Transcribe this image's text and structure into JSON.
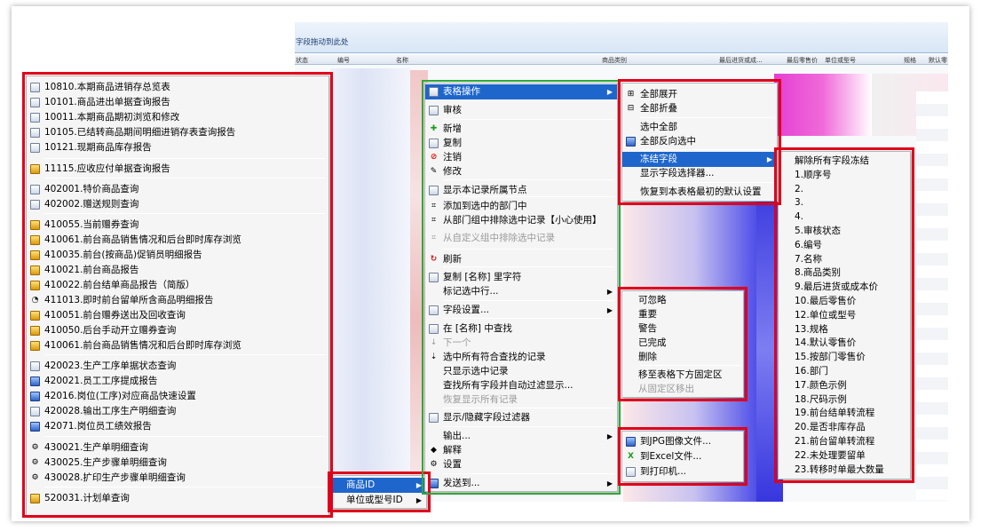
{
  "background_grid": {
    "drag_hint": "字段拖动到此处",
    "columns": [
      "状态",
      "编号",
      "名称",
      "商品类别",
      "最后进货或成...",
      "最后零售价",
      "单位或型号",
      "规格",
      "默认零"
    ]
  },
  "reports_menu": {
    "items": [
      {
        "label": "10810.本期商品进销存总览表",
        "icon": "report-icon"
      },
      {
        "label": "10101.商品进出单据查询报告",
        "icon": "report-icon"
      },
      {
        "label": "10011.本期商品期初浏览和修改",
        "icon": "report-icon"
      },
      {
        "label": "10105.已结转商品期间明细进销存表查询报告",
        "icon": "report-icon"
      },
      {
        "label": "10121.现期商品库存报告",
        "icon": "report-icon"
      },
      {
        "label": "11115.应收应付单据查询报告",
        "icon": "chart-icon"
      },
      {
        "label": "402001.特价商品查询",
        "icon": "report-icon"
      },
      {
        "label": "402002.赠送规则查询",
        "icon": "report-icon"
      },
      {
        "label": "410055.当前赠券查询",
        "icon": "coupon-icon"
      },
      {
        "label": "410061.前台商品销售情况和后台即时库存浏览",
        "icon": "coupon-icon"
      },
      {
        "label": "410035.前台(按商品)促销员明细报告",
        "icon": "coupon-icon"
      },
      {
        "label": "410021.前台商品报告",
        "icon": "coupon-icon"
      },
      {
        "label": "410022.前台结单商品报告（简版）",
        "icon": "coupon-icon"
      },
      {
        "label": "411013.即时前台留单所含商品明细报告",
        "icon": "clock-icon"
      },
      {
        "label": "410051.前台赠券送出及回收查询",
        "icon": "coupon-icon"
      },
      {
        "label": "410050.后台手动开立赠券查询",
        "icon": "coupon-icon"
      },
      {
        "label": "410061.前台商品销售情况和后台即时库存浏览",
        "icon": "coupon-icon"
      },
      {
        "label": "420023.生产工序单据状态查询",
        "icon": "report-icon"
      },
      {
        "label": "420021.员工工序提成报告",
        "icon": "staff-icon"
      },
      {
        "label": "42016.岗位(工序)对应商品快速设置",
        "icon": "staff-icon"
      },
      {
        "label": "420028.输出工序生产明细查询",
        "icon": "report-icon"
      },
      {
        "label": "42071.岗位员工绩效报告",
        "icon": "staff-icon"
      },
      {
        "label": "430021.生产单明细查询",
        "icon": "gear-icon"
      },
      {
        "label": "430025.生产步骤单明细查询",
        "icon": "gear-icon"
      },
      {
        "label": "430028.扩印生产步骤单明细查询",
        "icon": "gear-icon"
      },
      {
        "label": "520031.计划单查询",
        "icon": "pencil-icon"
      }
    ]
  },
  "field_menu": {
    "items": [
      {
        "label": "商品ID",
        "highlighted": true
      },
      {
        "label": "单位或型号ID",
        "highlighted": false
      }
    ]
  },
  "context_menu": {
    "items": [
      {
        "label": "表格操作",
        "icon": "table-icon",
        "submenu": true,
        "highlighted": true
      },
      {
        "label": "审核",
        "icon": "check-icon"
      },
      {
        "label": "新增",
        "icon": "add-icon"
      },
      {
        "label": "复制",
        "icon": "copy-icon"
      },
      {
        "label": "注销",
        "icon": "cancel-icon"
      },
      {
        "label": "修改",
        "icon": "edit-icon"
      },
      {
        "label": "显示本记录所属节点",
        "icon": "node-icon"
      },
      {
        "label": "添加到选中的部门中",
        "icon": "dept-add-icon"
      },
      {
        "label": "从部门组中排除选中记录【小心使用】",
        "icon": "dept-remove-icon"
      },
      {
        "label": "从自定义组中排除选中记录",
        "icon": "group-remove-icon",
        "disabled": true
      },
      {
        "label": "刷新",
        "icon": "refresh-icon"
      },
      {
        "label": "复制 [名称] 里字符",
        "icon": "copy-icon"
      },
      {
        "label": "标记选中行...",
        "icon": "",
        "submenu": true
      },
      {
        "label": "字段设置...",
        "icon": "field-icon",
        "submenu": true
      },
      {
        "label": "在 [名称] 中查找",
        "icon": "find-icon"
      },
      {
        "label": "下一个",
        "icon": "next-icon",
        "disabled": true
      },
      {
        "label": "选中所有符合查找的记录",
        "icon": "select-icon"
      },
      {
        "label": "只显示选中记录",
        "icon": ""
      },
      {
        "label": "查找所有字段并自动过滤显示...",
        "icon": ""
      },
      {
        "label": "恢复显示所有记录",
        "icon": "",
        "disabled": true
      },
      {
        "label": "显示/隐藏字段过滤器",
        "icon": "filter-icon"
      },
      {
        "label": "输出...",
        "icon": "",
        "submenu": true
      },
      {
        "label": "解释",
        "icon": "info-icon"
      },
      {
        "label": "设置",
        "icon": "settings-icon"
      },
      {
        "label": "发送到...",
        "icon": "send-icon",
        "submenu": true
      }
    ]
  },
  "table_ops_menu": {
    "items": [
      {
        "label": "全部展开",
        "icon": "expand-icon"
      },
      {
        "label": "全部折叠",
        "icon": "collapse-icon"
      },
      {
        "label": "选中全部",
        "icon": ""
      },
      {
        "label": "全部反向选中",
        "icon": "invert-icon"
      },
      {
        "label": "冻结字段",
        "icon": "",
        "submenu": true,
        "highlighted": true
      },
      {
        "label": "显示字段选择器...",
        "icon": ""
      },
      {
        "label": "恢复到本表格最初的默认设置",
        "icon": ""
      }
    ]
  },
  "freeze_menu": {
    "items": [
      "解除所有字段冻结",
      "1.顺序号",
      "2.",
      "3.",
      "4.",
      "5.审核状态",
      "6.编号",
      "7.名称",
      "8.商品类别",
      "9.最后进货或成本价",
      "10.最后零售价",
      "12.单位或型号",
      "13.规格",
      "14.默认零售价",
      "15.按部门零售价",
      "16.部门",
      "17.颜色示例",
      "18.尺码示例",
      "19.前台结单转流程",
      "20.是否非库存品",
      "21.前台留单转流程",
      "22.未处理要留单",
      "23.转移时单最大数量"
    ]
  },
  "mark_menu": {
    "items": [
      {
        "label": "可忽略",
        "disabled": false
      },
      {
        "label": "重要",
        "disabled": false
      },
      {
        "label": "警告",
        "disabled": false
      },
      {
        "label": "已完成",
        "disabled": false
      },
      {
        "label": "删除",
        "disabled": false
      },
      {
        "label": "移至表格下方固定区",
        "disabled": false
      },
      {
        "label": "从固定区移出",
        "disabled": true
      }
    ]
  },
  "output_menu": {
    "items": [
      {
        "label": "到JPG图像文件...",
        "icon": "image-icon"
      },
      {
        "label": "到Excel文件...",
        "icon": "excel-icon"
      },
      {
        "label": "到打印机...",
        "icon": "printer-icon"
      }
    ]
  },
  "colors": {
    "highlight": "#1e66cc",
    "annotation_red": "#e0001b",
    "annotation_green": "#2ea83a"
  }
}
